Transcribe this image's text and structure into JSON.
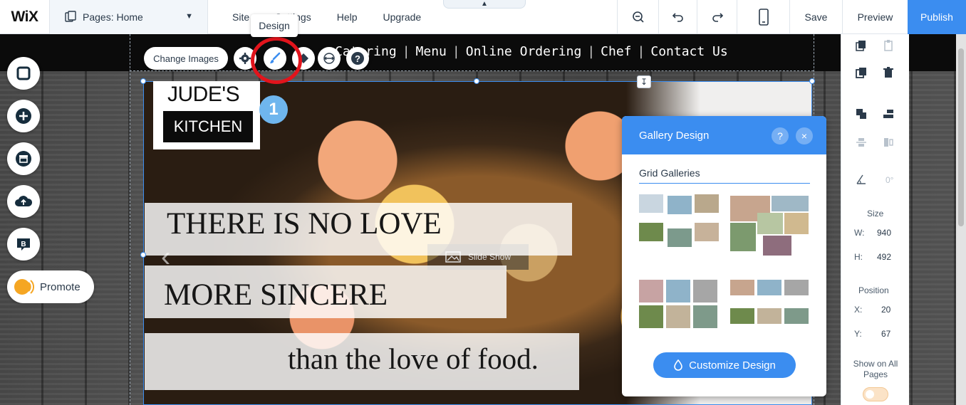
{
  "topbar": {
    "logo": "WiX",
    "pages_label": "Pages: Home",
    "menu": [
      "Site",
      "Settings",
      "Help",
      "Upgrade"
    ],
    "save": "Save",
    "preview": "Preview",
    "publish": "Publish"
  },
  "tooltip": {
    "design": "Design"
  },
  "site_nav": [
    "Catering",
    "Menu",
    "Online Ordering",
    "Chef",
    "Contact Us"
  ],
  "left_panel": {
    "promote": "Promote"
  },
  "element_toolbar": {
    "change_images": "Change Images"
  },
  "logo": {
    "top": "JUDE'S",
    "bottom": "KITCHEN"
  },
  "badge": "1",
  "headline": {
    "line1": "THERE IS NO LOVE",
    "line2": "MORE SINCERE",
    "line3": "than the love of food."
  },
  "slideshow_label": "Slide Show",
  "gallery_design": {
    "title": "Gallery Design",
    "help": "?",
    "close": "×",
    "section": "Grid Galleries",
    "customize": "Customize Design"
  },
  "inspector": {
    "rotation": "0°",
    "size_label": "Size",
    "w_label": "W:",
    "w_value": "940",
    "h_label": "H:",
    "h_value": "492",
    "position_label": "Position",
    "x_label": "X:",
    "x_value": "20",
    "y_label": "Y:",
    "y_value": "67",
    "show_all_pages": "Show on All Pages"
  },
  "colors": {
    "accent": "#3b8df0",
    "highlight": "#e2141c",
    "badge": "#6fb6ee"
  }
}
